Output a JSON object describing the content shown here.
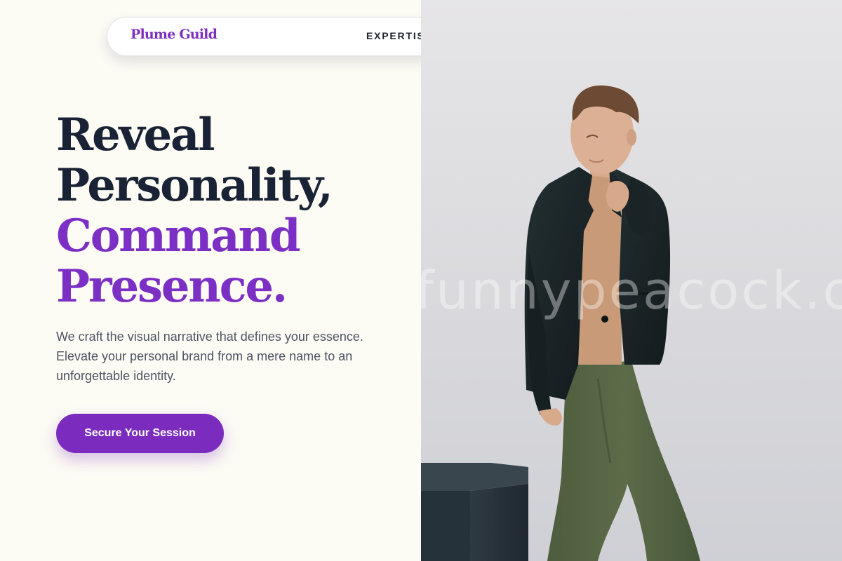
{
  "brand": {
    "name": "Plume Guild"
  },
  "nav": {
    "items": [
      "EXPERTISE"
    ]
  },
  "hero": {
    "headline_line1": "Reveal",
    "headline_line2": "Personality,",
    "headline_line3": "Command",
    "headline_line4": "Presence.",
    "description": "We craft the visual narrative that defines your essence. Elevate your personal brand from a mere name to an unforgettable identity.",
    "cta_label": "Secure Your Session"
  },
  "photo": {
    "watermark": "funnypeacock.com"
  },
  "colors": {
    "accent": "#7b2cbf",
    "heading_dark": "#1a2336",
    "page_background": "#fcfbf4"
  }
}
